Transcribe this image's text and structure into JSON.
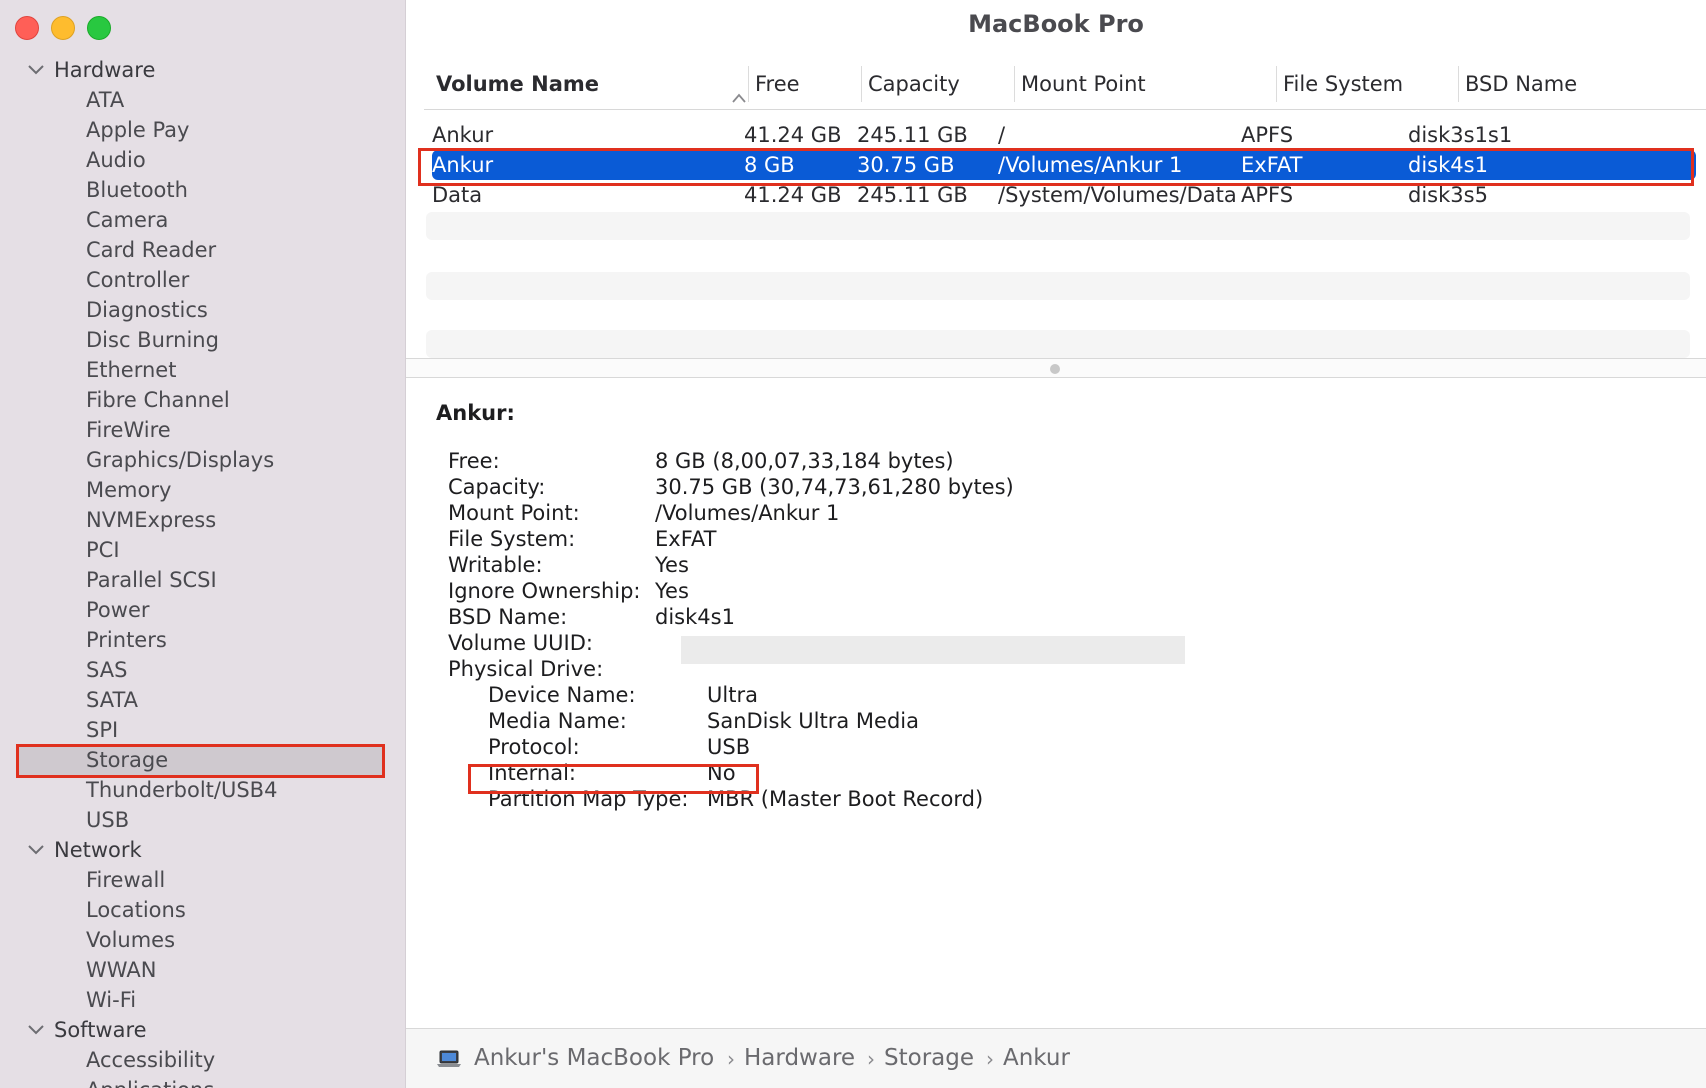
{
  "window": {
    "title": "MacBook Pro"
  },
  "sidebar": {
    "groups": [
      {
        "label": "Hardware",
        "items": [
          "ATA",
          "Apple Pay",
          "Audio",
          "Bluetooth",
          "Camera",
          "Card Reader",
          "Controller",
          "Diagnostics",
          "Disc Burning",
          "Ethernet",
          "Fibre Channel",
          "FireWire",
          "Graphics/Displays",
          "Memory",
          "NVMExpress",
          "PCI",
          "Parallel SCSI",
          "Power",
          "Printers",
          "SAS",
          "SATA",
          "SPI",
          "Storage",
          "Thunderbolt/USB4",
          "USB"
        ]
      },
      {
        "label": "Network",
        "items": [
          "Firewall",
          "Locations",
          "Volumes",
          "WWAN",
          "Wi-Fi"
        ]
      },
      {
        "label": "Software",
        "items": [
          "Accessibility",
          "Applications"
        ]
      }
    ],
    "selected": "Storage"
  },
  "table": {
    "columns": [
      "Volume Name",
      "Free",
      "Capacity",
      "Mount Point",
      "File System",
      "BSD Name"
    ],
    "rows": [
      [
        "Ankur",
        "41.24 GB",
        "245.11 GB",
        "/",
        "APFS",
        "disk3s1s1"
      ],
      [
        "Ankur",
        "8 GB",
        "30.75 GB",
        "/Volumes/Ankur 1",
        "ExFAT",
        "disk4s1"
      ],
      [
        "Data",
        "41.24 GB",
        "245.11 GB",
        "/System/Volumes/Data",
        "APFS",
        "disk3s5"
      ]
    ],
    "selected_row": 1,
    "sort_icon": "chevron-up-icon"
  },
  "detail": {
    "title": "Ankur:",
    "fields": [
      {
        "label": "Free:",
        "value": "8 GB (8,00,07,33,184 bytes)"
      },
      {
        "label": "Capacity:",
        "value": "30.75 GB (30,74,73,61,280 bytes)"
      },
      {
        "label": "Mount Point:",
        "value": "/Volumes/Ankur 1"
      },
      {
        "label": "File System:",
        "value": "ExFAT"
      },
      {
        "label": "Writable:",
        "value": "Yes"
      },
      {
        "label": "Ignore Ownership:",
        "value": "Yes"
      },
      {
        "label": "BSD Name:",
        "value": "disk4s1"
      },
      {
        "label": "Volume UUID:",
        "value": ""
      },
      {
        "label": "Physical Drive:",
        "value": ""
      }
    ],
    "physical_drive": [
      {
        "label": "Device Name:",
        "value": "Ultra"
      },
      {
        "label": "Media Name:",
        "value": "SanDisk Ultra Media"
      },
      {
        "label": "Protocol:",
        "value": "USB"
      },
      {
        "label": "Internal:",
        "value": "No"
      },
      {
        "label": "Partition Map Type:",
        "value": "MBR (Master Boot Record)"
      }
    ]
  },
  "pathbar": {
    "icon": "laptop-icon",
    "crumbs": [
      "Ankur's MacBook Pro",
      "Hardware",
      "Storage",
      "Ankur"
    ],
    "separator": "›"
  },
  "colors": {
    "selection": "#0a5bd6",
    "highlight_box": "#e0301e",
    "sidebar_bg": "#e5dfe5"
  }
}
